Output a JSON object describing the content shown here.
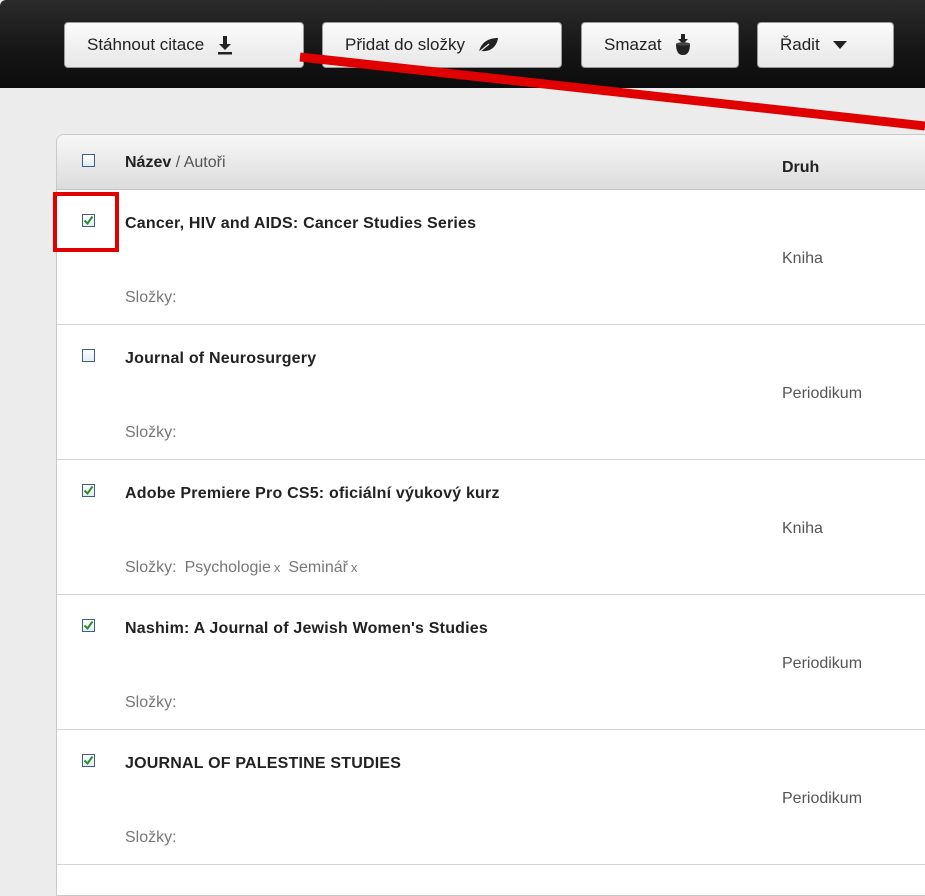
{
  "toolbar": {
    "download": {
      "label": "Stáhnout citace",
      "icon": "download-icon"
    },
    "folder": {
      "label": "Přidat do složky",
      "icon": "leaf-icon"
    },
    "delete": {
      "label": "Smazat",
      "icon": "trash-icon"
    },
    "sort": {
      "label": "Řadit",
      "icon": "caret-down-icon"
    }
  },
  "list": {
    "header": {
      "title_label": "Název",
      "authors_label": "Autoři",
      "type_label": "Druh",
      "checked": false
    },
    "folders_label": "Složky:",
    "rows": [
      {
        "title": "Cancer, HIV and AIDS: Cancer Studies Series",
        "type": "Kniha",
        "checked": true,
        "folders": []
      },
      {
        "title": "Journal of Neurosurgery",
        "type": "Periodikum",
        "checked": false,
        "folders": []
      },
      {
        "title": "Adobe Premiere Pro CS5: oficiální výukový kurz",
        "type": "Kniha",
        "checked": true,
        "folders": [
          "Psychologie",
          "Seminář"
        ]
      },
      {
        "title": "Nashim: A Journal of Jewish Women's Studies",
        "type": "Periodikum",
        "checked": true,
        "folders": []
      },
      {
        "title": "JOURNAL OF PALESTINE STUDIES",
        "type": "Periodikum",
        "checked": true,
        "folders": []
      }
    ],
    "tag_remove": "x"
  },
  "colors": {
    "accent": "#2e8b2e",
    "annotation": "#e00000",
    "toolbar_bg": "#151515"
  }
}
